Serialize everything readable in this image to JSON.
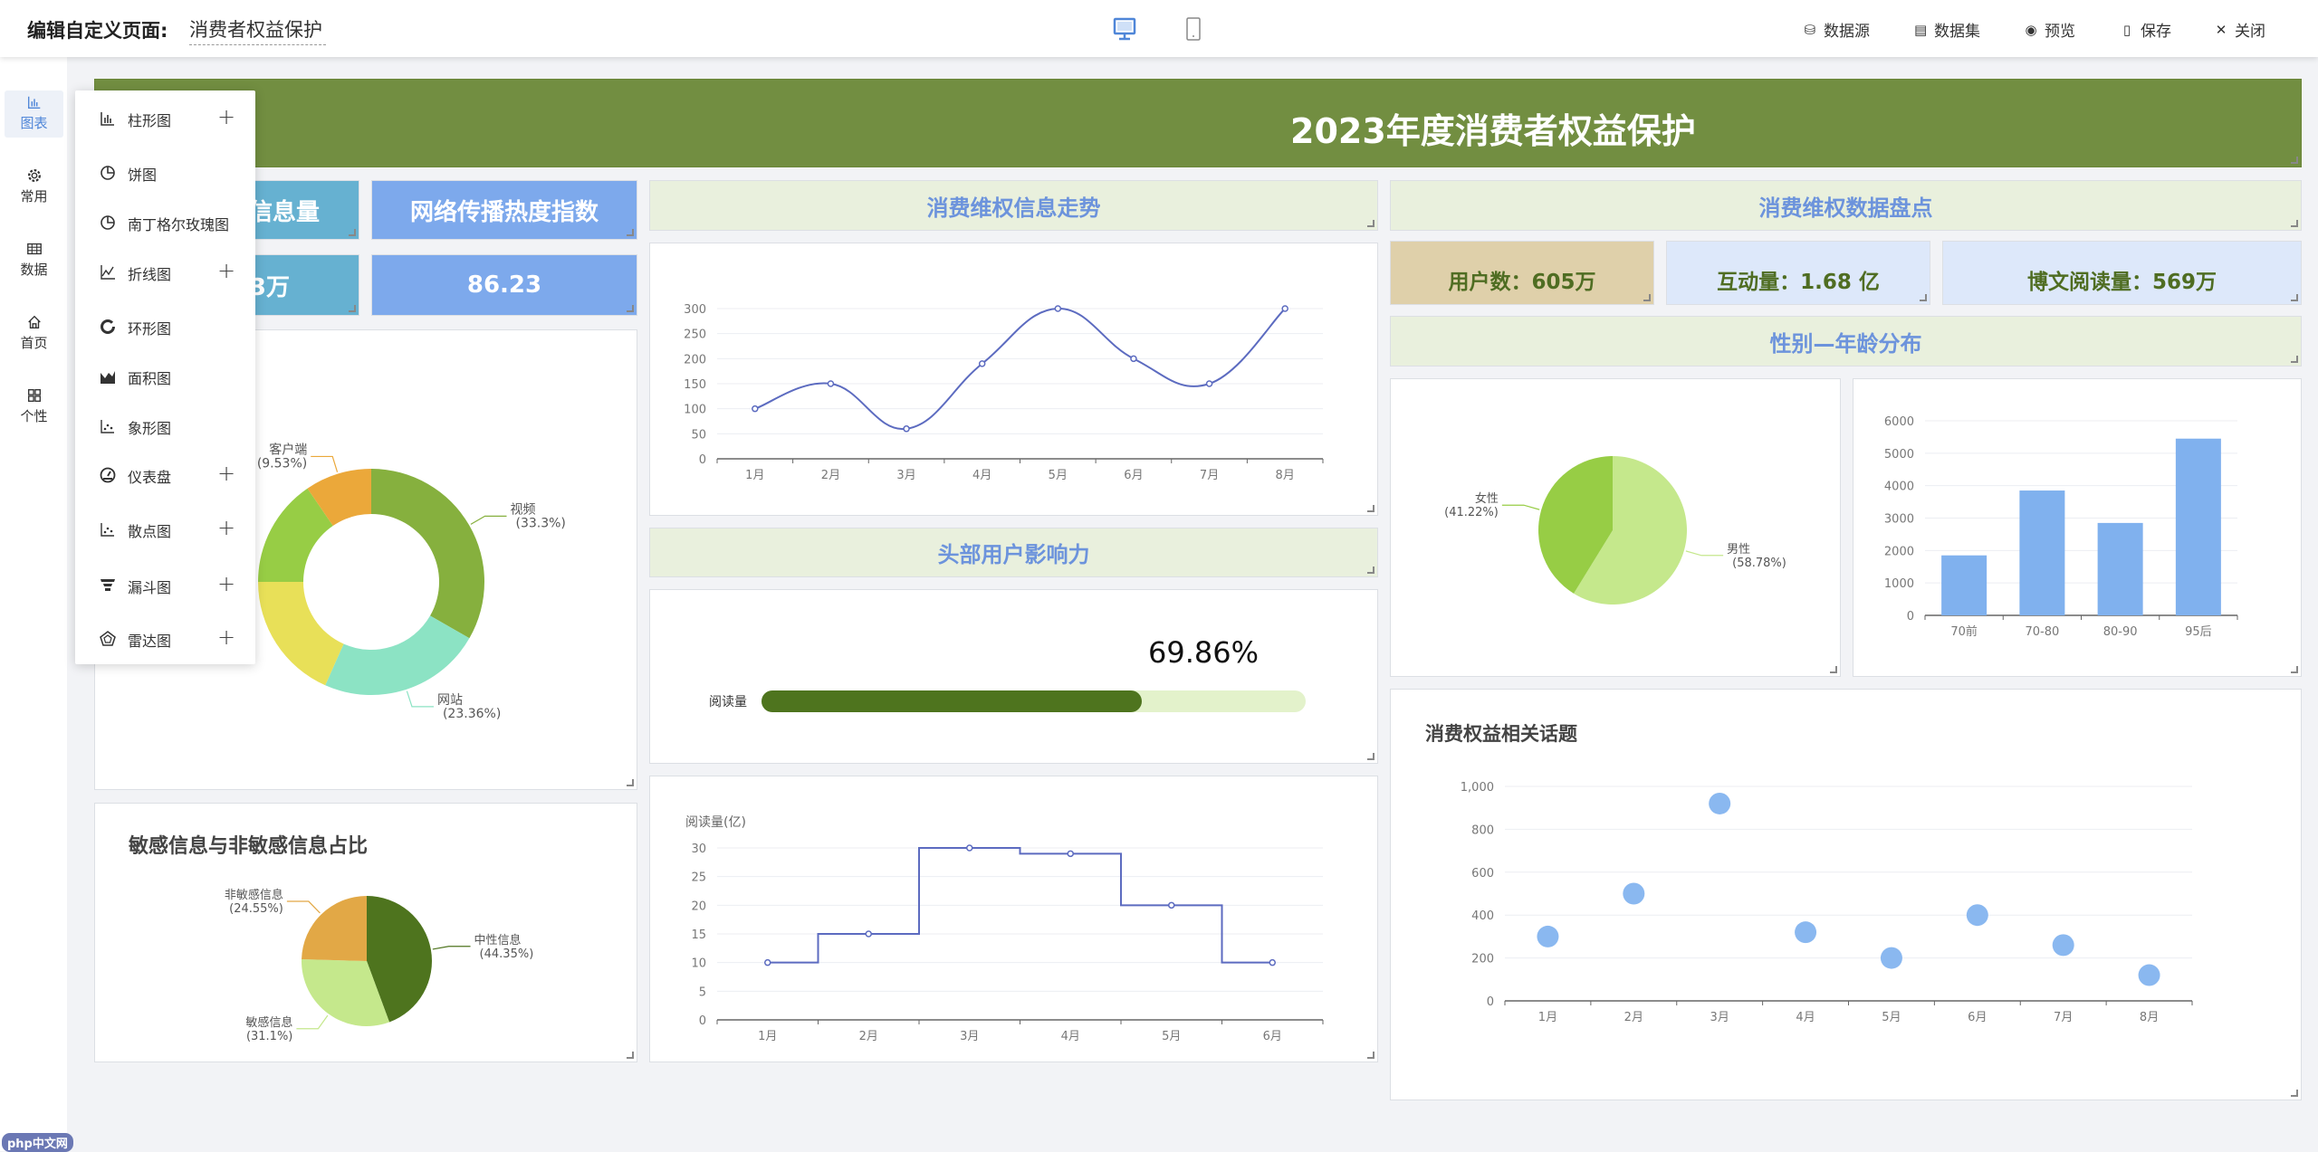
{
  "header": {
    "title_label": "编辑自定义页面:",
    "page_name": "消费者权益保护",
    "devices": [
      {
        "name": "desktop",
        "active": true
      },
      {
        "name": "mobile",
        "active": false
      }
    ],
    "actions": [
      {
        "label": "数据源",
        "icon": "database-icon",
        "glyph": "⛁"
      },
      {
        "label": "数据集",
        "icon": "dataset-icon",
        "glyph": "▤"
      },
      {
        "label": "预览",
        "icon": "eye-icon",
        "glyph": "◉"
      },
      {
        "label": "保存",
        "icon": "save-icon",
        "glyph": "▯"
      },
      {
        "label": "关闭",
        "icon": "close-icon",
        "glyph": "✕"
      }
    ]
  },
  "rail": {
    "active_color": "#4f86d8",
    "items": [
      {
        "label": "图表",
        "icon": "bar-chart",
        "active": true
      },
      {
        "label": "常用",
        "icon": "gear",
        "active": false
      },
      {
        "label": "数据",
        "icon": "table-grid",
        "active": false
      },
      {
        "label": "首页",
        "icon": "home",
        "active": false
      },
      {
        "label": "个性",
        "icon": "apps",
        "active": false
      }
    ]
  },
  "chart_menu": {
    "items": [
      {
        "label": "柱形图",
        "icon": "bar-chart",
        "expandable": true
      },
      {
        "label": "饼图",
        "icon": "pie-chart",
        "expandable": false
      },
      {
        "label": "南丁格尔玫瑰图",
        "icon": "pie-chart",
        "expandable": false
      },
      {
        "label": "折线图",
        "icon": "line-chart",
        "expandable": true
      },
      {
        "label": "环形图",
        "icon": "donut",
        "expandable": false
      },
      {
        "label": "面积图",
        "icon": "area-chart",
        "expandable": false
      },
      {
        "label": "象形图",
        "icon": "scatter",
        "expandable": false
      },
      {
        "label": "仪表盘",
        "icon": "gauge",
        "expandable": true
      },
      {
        "label": "散点图",
        "icon": "scatter",
        "expandable": true
      },
      {
        "label": "漏斗图",
        "icon": "funnel",
        "expandable": true
      },
      {
        "label": "雷达图",
        "icon": "radar",
        "expandable": true
      }
    ]
  },
  "banner": {
    "title": "2023年度消费者权益保护",
    "color": "#728e41"
  },
  "left_kpis": {
    "tile_a": {
      "label": "信息量",
      "value": "3万",
      "color": "#66b1d1"
    },
    "tile_b": {
      "label": "网络传播热度指数",
      "value": "86.23",
      "color": "#7da9ec"
    }
  },
  "section_titles": {
    "trend": "消费维权信息走势",
    "inventory": "消费维权数据盘点",
    "influence": "头部用户影响力",
    "gender_age": "性别—年龄分布"
  },
  "right_kpis": [
    {
      "text": "用户数：605万",
      "bg": "#dfd0aa"
    },
    {
      "text": "互动量：1.68 亿",
      "bg": "#dde8fa"
    },
    {
      "text": "博文阅读量：569万",
      "bg": "#dde8fa"
    }
  ],
  "progress": {
    "label": "阅读量",
    "value_text": "69.86%",
    "value": 69.86,
    "fill": "#4e741e",
    "track": "#e3f2cb"
  },
  "chart_data": [
    {
      "id": "donut",
      "type": "pie",
      "variant": "donut",
      "slices": [
        {
          "name": "视频",
          "value": 33.3,
          "color": "#86b03e"
        },
        {
          "name": "网站",
          "value": 23.36,
          "color": "#8ce3c4"
        },
        {
          "name": "",
          "value": 18.34,
          "color": "#e8e058"
        },
        {
          "name": "",
          "value": 15.47,
          "color": "#97cd45"
        },
        {
          "name": "客户端",
          "value": 9.53,
          "color": "#eba83a"
        }
      ]
    },
    {
      "id": "sensitive",
      "type": "pie",
      "title": "敏感信息与非敏感信息占比",
      "slices": [
        {
          "name": "中性信息",
          "value": 44.35,
          "color": "#4e741e"
        },
        {
          "name": "敏感信息",
          "value": 31.1,
          "color": "#c5e88c"
        },
        {
          "name": "非敏感信息",
          "value": 24.55,
          "color": "#e2a846"
        }
      ]
    },
    {
      "id": "trend",
      "type": "line",
      "smooth": true,
      "color": "#5c6bc0",
      "categories": [
        "1月",
        "2月",
        "3月",
        "4月",
        "5月",
        "6月",
        "7月",
        "8月"
      ],
      "values": [
        100,
        150,
        60,
        190,
        300,
        200,
        150,
        300
      ],
      "ylim": [
        0,
        300
      ],
      "ystep": 50
    },
    {
      "id": "reading",
      "type": "line",
      "step": "middle",
      "color": "#5c6bc0",
      "ylabel": "阅读量(亿)",
      "categories": [
        "1月",
        "2月",
        "3月",
        "4月",
        "5月",
        "6月"
      ],
      "values": [
        10,
        15,
        30,
        29,
        20,
        10
      ],
      "ylim": [
        0,
        30
      ],
      "ystep": 5
    },
    {
      "id": "gender",
      "type": "pie",
      "slices": [
        {
          "name": "男性",
          "value": 58.78,
          "color": "#c5e88c"
        },
        {
          "name": "女性",
          "value": 41.22,
          "color": "#97cd45"
        }
      ]
    },
    {
      "id": "age",
      "type": "bar",
      "color": "#80b1ee",
      "categories": [
        "70前",
        "70-80",
        "80-90",
        "95后"
      ],
      "values": [
        1850,
        3850,
        2850,
        5450
      ],
      "ylim": [
        0,
        6000
      ],
      "ystep": 1000
    },
    {
      "id": "topics",
      "type": "scatter",
      "title": "消费权益相关话题",
      "color": "#8ab8f0",
      "categories": [
        "1月",
        "2月",
        "3月",
        "4月",
        "5月",
        "6月",
        "7月",
        "8月"
      ],
      "values": [
        300,
        500,
        920,
        320,
        200,
        400,
        260,
        120
      ],
      "ylim": [
        0,
        1000
      ],
      "ystep": 200,
      "thousands_sep": true
    }
  ],
  "watermark": {
    "text": "php中文网"
  }
}
